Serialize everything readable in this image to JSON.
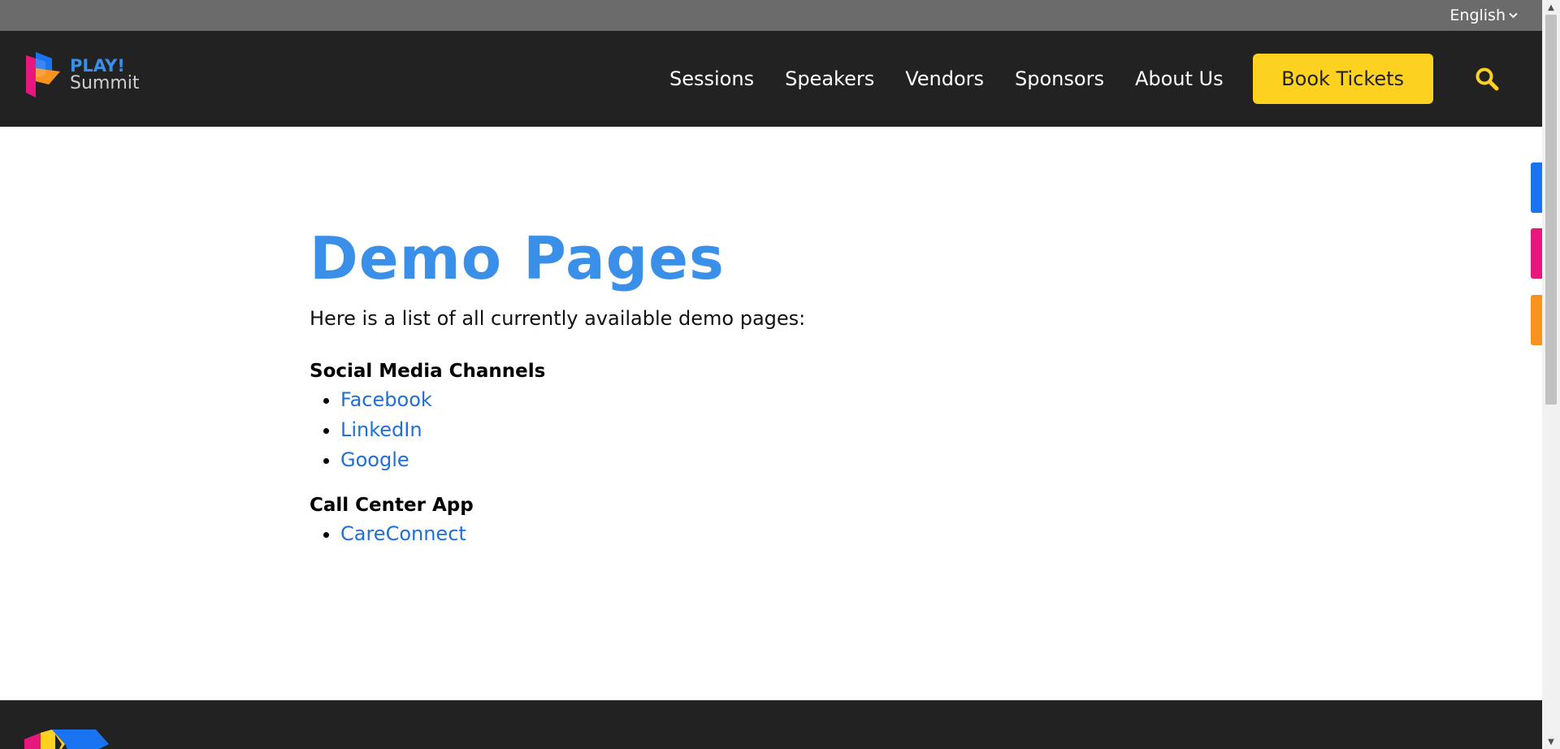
{
  "topbar": {
    "language": "English"
  },
  "brand": {
    "line1": "PLAY!",
    "line2": "Summit"
  },
  "nav": {
    "items": [
      {
        "label": "Sessions"
      },
      {
        "label": "Speakers"
      },
      {
        "label": "Vendors"
      },
      {
        "label": "Sponsors"
      },
      {
        "label": "About Us"
      }
    ],
    "cta": "Book Tickets"
  },
  "icons": {
    "search": "search-icon",
    "language_dropdown": "chevron-down-icon"
  },
  "main": {
    "title": "Demo Pages",
    "intro": "Here is a list of all currently available demo pages:",
    "sections": [
      {
        "title": "Social Media Channels",
        "links": [
          "Facebook",
          "LinkedIn",
          "Google"
        ]
      },
      {
        "title": "Call Center App",
        "links": [
          "CareConnect"
        ]
      }
    ]
  },
  "colors": {
    "accent_blue": "#3a8fe8",
    "cta_yellow": "#fdd11f",
    "header_bg": "#222222",
    "topbar_bg": "#6b6b6b",
    "side_tab_blue": "#1a73f0",
    "side_tab_pink": "#e8177e",
    "side_tab_orange": "#f7931e"
  }
}
